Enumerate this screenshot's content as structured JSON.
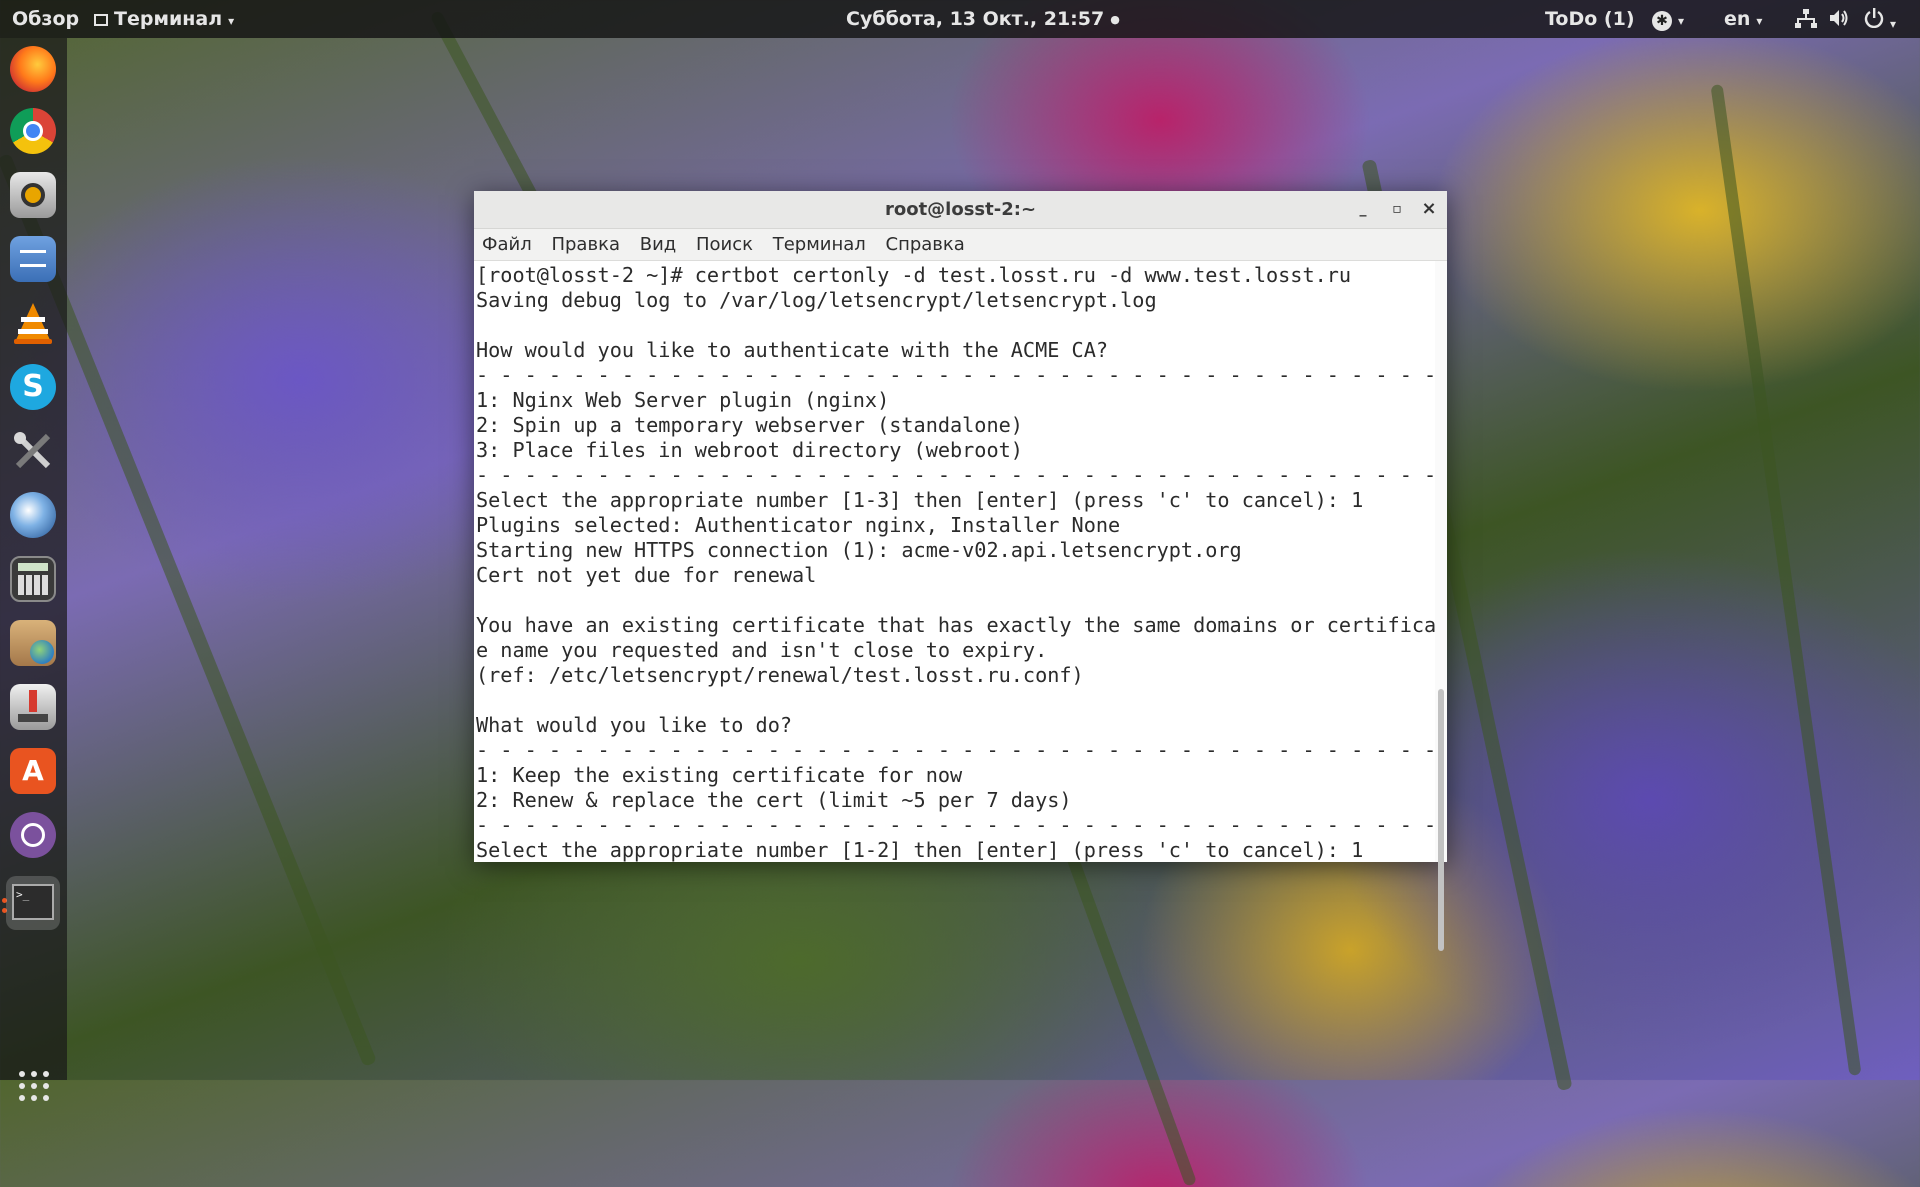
{
  "topbar": {
    "activities": "Обзор",
    "app_menu": "Терминал",
    "clock": "Суббота, 13 Окт., 21:57",
    "todo": "ToDo (1)",
    "language": "en"
  },
  "dock": {
    "apps": [
      "firefox",
      "chrome",
      "rhythmbox",
      "files",
      "vlc",
      "skype",
      "system-tools",
      "thunderbird",
      "calculator",
      "file-manager-globe",
      "install-tool",
      "software-center",
      "viber",
      "terminal"
    ]
  },
  "window": {
    "title": "root@losst-2:~",
    "minimize": "_",
    "maximize": "▫",
    "close": "×",
    "menu": [
      "Файл",
      "Правка",
      "Вид",
      "Поиск",
      "Терминал",
      "Справка"
    ]
  },
  "terminal": {
    "lines": [
      "[root@losst-2 ~]# certbot certonly -d test.losst.ru -d www.test.losst.ru",
      "Saving debug log to /var/log/letsencrypt/letsencrypt.log",
      "",
      "How would you like to authenticate with the ACME CA?",
      "- - - - - - - - - - - - - - - - - - - - - - - - - - - - - - - - - - - - - - - -",
      "1: Nginx Web Server plugin (nginx)",
      "2: Spin up a temporary webserver (standalone)",
      "3: Place files in webroot directory (webroot)",
      "- - - - - - - - - - - - - - - - - - - - - - - - - - - - - - - - - - - - - - - -",
      "Select the appropriate number [1-3] then [enter] (press 'c' to cancel): 1",
      "Plugins selected: Authenticator nginx, Installer None",
      "Starting new HTTPS connection (1): acme-v02.api.letsencrypt.org",
      "Cert not yet due for renewal",
      "",
      "You have an existing certificate that has exactly the same domains or certificat",
      "e name you requested and isn't close to expiry.",
      "(ref: /etc/letsencrypt/renewal/test.losst.ru.conf)",
      "",
      "What would you like to do?",
      "- - - - - - - - - - - - - - - - - - - - - - - - - - - - - - - - - - - - - - - -",
      "1: Keep the existing certificate for now",
      "2: Renew & replace the cert (limit ~5 per 7 days)",
      "- - - - - - - - - - - - - - - - - - - - - - - - - - - - - - - - - - - - - - - -",
      "Select the appropriate number [1-2] then [enter] (press 'c' to cancel): 1"
    ]
  }
}
